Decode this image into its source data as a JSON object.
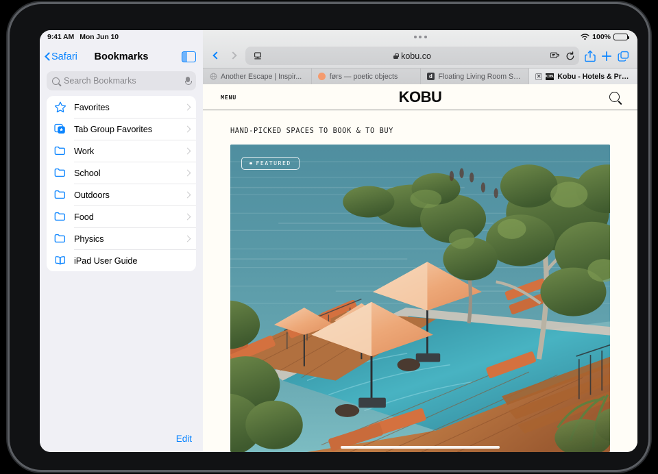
{
  "device": {
    "status_bar": {
      "time": "9:41 AM",
      "date": "Mon Jun 10"
    },
    "browser_status": {
      "battery_percent": "100%",
      "wifi_icon": "wifi-icon",
      "battery_icon": "battery-icon"
    }
  },
  "sidebar": {
    "back_label": "Safari",
    "title": "Bookmarks",
    "toggle_icon": "sidebar-toggle-icon",
    "search": {
      "placeholder": "Search Bookmarks",
      "value": "",
      "icon": "search-icon",
      "mic_icon": "microphone-icon"
    },
    "items": [
      {
        "label": "Favorites",
        "icon": "star-icon",
        "chevron": "chevron-right-icon"
      },
      {
        "label": "Tab Group Favorites",
        "icon": "tab-group-star-icon",
        "chevron": "chevron-right-icon"
      },
      {
        "label": "Work",
        "icon": "folder-icon",
        "chevron": "chevron-right-icon"
      },
      {
        "label": "School",
        "icon": "folder-icon",
        "chevron": "chevron-right-icon"
      },
      {
        "label": "Outdoors",
        "icon": "folder-icon",
        "chevron": "chevron-right-icon"
      },
      {
        "label": "Food",
        "icon": "folder-icon",
        "chevron": "chevron-right-icon"
      },
      {
        "label": "Physics",
        "icon": "folder-icon",
        "chevron": "chevron-right-icon"
      },
      {
        "label": "iPad User Guide",
        "icon": "book-icon",
        "chevron": ""
      }
    ],
    "edit_label": "Edit"
  },
  "browser": {
    "back_icon": "chevron-left-icon",
    "forward_icon": "chevron-right-icon",
    "address": {
      "url": "kobu.co",
      "lock_icon": "lock-icon",
      "display_menu_icon": "page-display-menu-icon"
    },
    "actions": {
      "extensions_icon": "extensions-icon",
      "reload_icon": "reload-icon",
      "share_icon": "share-icon",
      "new_tab_icon": "plus-icon",
      "tab_overview_icon": "tab-overview-icon"
    },
    "tabs": [
      {
        "title": "Another Escape | Inspir...",
        "favicon": "globe-favicon",
        "active": false,
        "close_icon": ""
      },
      {
        "title": "førs — poetic objects",
        "favicon": "orange-circle-favicon",
        "active": false,
        "close_icon": ""
      },
      {
        "title": "Floating Living Room Se...",
        "favicon": "letter-d-favicon",
        "active": false,
        "close_icon": ""
      },
      {
        "title": "Kobu - Hotels & Propert...",
        "favicon": "kobu-favicon",
        "active": true,
        "close_icon": "close-icon"
      }
    ]
  },
  "page": {
    "menu_label": "MENU",
    "logo": "KOBU",
    "search_icon": "search-icon",
    "tagline": "HAND-PICKED SPACES TO BOOK & TO BUY",
    "hero": {
      "badge_label": "FEATURED",
      "badge_dot": "dot-icon",
      "alt": "Aerial view of a clifftop resort infinity pool with orange umbrellas, wooden deck and teal ocean"
    }
  },
  "colors": {
    "ios_blue": "#0a84ff",
    "sidebar_bg": "#f0f0f5",
    "page_bg": "#fffdf7",
    "ocean_teal": "#55919f",
    "umbrella_orange": "#e8a072",
    "deck_brown": "#a9683c"
  }
}
